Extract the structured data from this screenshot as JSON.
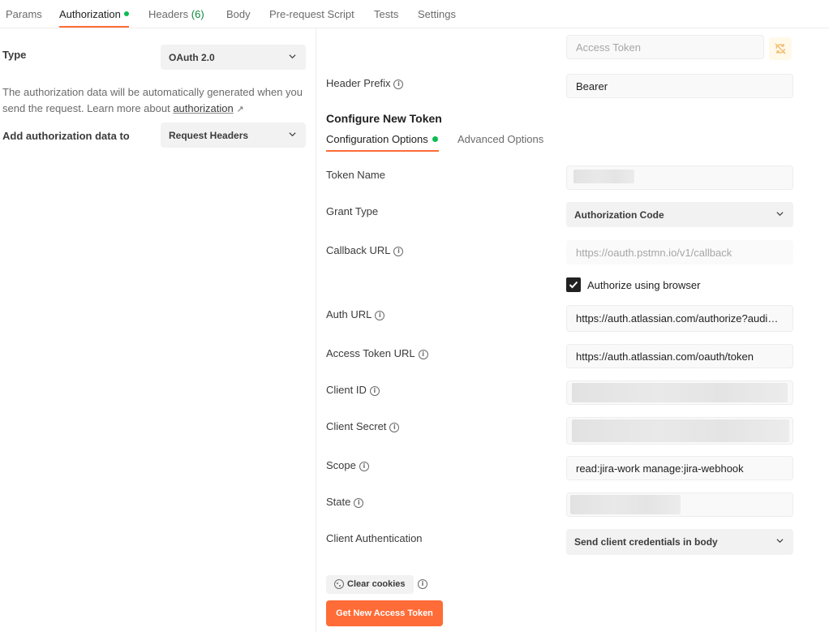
{
  "tabs": {
    "params": "Params",
    "authorization": "Authorization",
    "headers": "Headers",
    "headers_count": "(6)",
    "body": "Body",
    "pre_request": "Pre-request Script",
    "tests": "Tests",
    "settings": "Settings"
  },
  "left": {
    "type_label": "Type",
    "type_value": "OAuth 2.0",
    "description": "The authorization data will be automatically generated when you send the request. Learn more about ",
    "link_text": "authorization",
    "link_arrow": "↗",
    "add_to_label": "Add authorization data to",
    "add_to_value": "Request Headers"
  },
  "right": {
    "access_token_placeholder": "Access Token",
    "header_prefix_label": "Header Prefix",
    "header_prefix_value": "Bearer",
    "configure_heading": "Configure New Token",
    "subtabs": {
      "config": "Configuration Options",
      "advanced": "Advanced Options"
    },
    "token_name_label": "Token Name",
    "grant_type_label": "Grant Type",
    "grant_type_value": "Authorization Code",
    "callback_label": "Callback URL",
    "callback_value": "https://oauth.pstmn.io/v1/callback",
    "authorize_browser_label": "Authorize using browser",
    "authorize_browser_checked": true,
    "auth_url_label": "Auth URL",
    "auth_url_value": "https://auth.atlassian.com/authorize?audience=api.atlassian.com",
    "access_token_url_label": "Access Token URL",
    "access_token_url_value": "https://auth.atlassian.com/oauth/token",
    "client_id_label": "Client ID",
    "client_secret_label": "Client Secret",
    "scope_label": "Scope",
    "scope_value": "read:jira-work manage:jira-webhook",
    "state_label": "State",
    "client_auth_label": "Client Authentication",
    "client_auth_value": "Send client credentials in body",
    "clear_cookies": "Clear cookies",
    "get_token": "Get New Access Token"
  },
  "colors": {
    "accent": "#ff6c37",
    "status_dot": "#0cbb52"
  }
}
